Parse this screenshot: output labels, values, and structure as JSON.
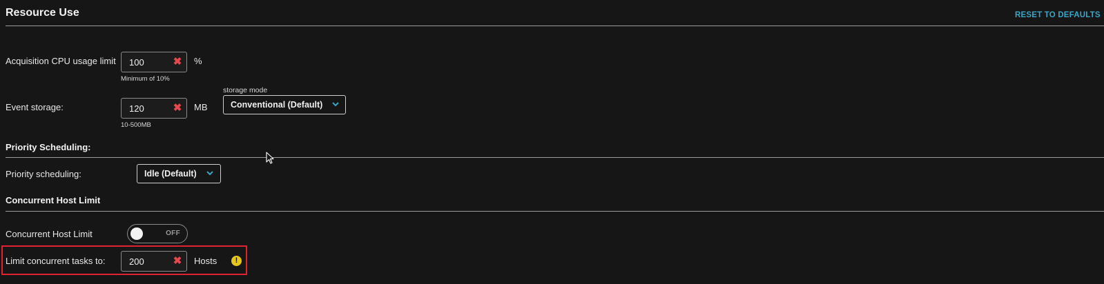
{
  "header": {
    "title": "Resource Use",
    "reset_label": "RESET TO DEFAULTS"
  },
  "cpu": {
    "label": "Acquisition CPU usage limit",
    "value": "100",
    "unit": "%",
    "hint": "Minimum of 10%"
  },
  "event_storage": {
    "label": "Event storage:",
    "value": "120",
    "unit": "MB",
    "hint": "10-500MB",
    "mode_label": "storage mode",
    "mode_value": "Conventional (Default)"
  },
  "priority": {
    "section": "Priority Scheduling:",
    "label": "Priority scheduling:",
    "value": "Idle (Default)"
  },
  "concurrent": {
    "section": "Concurrent Host Limit",
    "toggle_label": "Concurrent Host Limit",
    "toggle_state": "OFF",
    "limit_label": "Limit concurrent tasks to:",
    "limit_value": "200",
    "limit_unit": "Hosts"
  },
  "colors": {
    "accent": "#3aa6c7",
    "clear": "#e5484d",
    "highlight": "#e0232e",
    "warning": "#e6c619"
  },
  "icons": {
    "clear": "close-icon",
    "chevron": "chevron-down-icon",
    "warning": "warning-icon",
    "cursor": "mouse-cursor-icon"
  }
}
